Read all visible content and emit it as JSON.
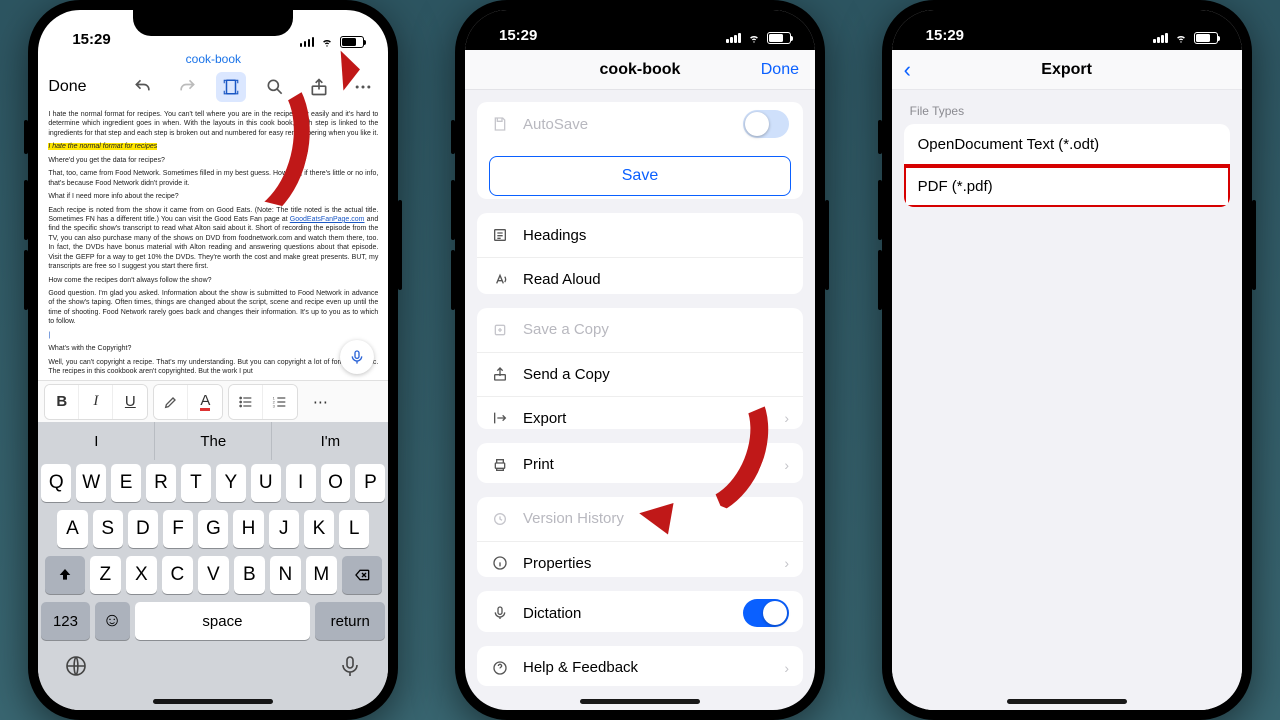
{
  "status": {
    "time": "15:29"
  },
  "phone1": {
    "doc_title": "cook-book",
    "done": "Done",
    "para_intro1": "I hate the normal format for recipes. You can't tell where you are in the recipe very easily and it's hard to determine which ingredient goes in when. With the layouts in this cook book, each step is linked to the ingredients for that step and each step is broken out and numbered for easy remembering when you like it.",
    "para_hl": "I hate the normal format for recipes",
    "para_q1": "Where'd you get the data for recipes?",
    "para_a1": "That, too, came from Food Network. Sometimes filled in my best guess. However, if there's little or no info, that's because Food Network didn't provide it.",
    "para_q2": "What if I need more info about the recipe?",
    "para_a2a": "Each recipe is noted from the show it came from on Good Eats. (Note: The title noted is the actual title. Sometimes FN has a different title.) You can visit the Good Eats Fan page at ",
    "para_link": "GoodEatsFanPage.com",
    "para_a2b": " and find the specific show's transcript to read what Alton said about it. Short of recording the episode from the TV, you can also purchase many of the shows on DVD from foodnetwork.com and watch them there, too. In fact, the DVDs have bonus material with Alton reading and answering questions about that episode. Visit the GEFP for a way to get 10% the DVDs. They're worth the cost and make great presents. BUT, my transcripts are free so I suggest you start there first.",
    "para_q3": "How come the recipes don't always follow the show?",
    "para_a3": "Good question. I'm glad you asked. Information about the show is submitted to Food Network in advance of the show's taping. Often times, things are changed about the script, scene and recipe even up until the time of shooting. Food Network rarely goes back and changes their information. It's up to you as to which to follow.",
    "para_q4": "What's with the Copyright?",
    "para_a4": "Well, you can't copyright a recipe. That's my understanding. But you can copyright a lot of formatting, etc. The recipes in this cookbook aren't copyrighted. But the work I put",
    "kb": {
      "sugg1": "I",
      "sugg2": "The",
      "sugg3": "I'm",
      "space": "space",
      "return": "return",
      "num": "123"
    }
  },
  "phone2": {
    "title": "cook-book",
    "done": "Done",
    "autosave": "AutoSave",
    "save": "Save",
    "headings": "Headings",
    "read_aloud": "Read Aloud",
    "save_copy": "Save a Copy",
    "send_copy": "Send a Copy",
    "export": "Export",
    "print": "Print",
    "version": "Version History",
    "properties": "Properties",
    "dictation": "Dictation",
    "help": "Help & Feedback"
  },
  "phone3": {
    "title": "Export",
    "section": "File Types",
    "odt": "OpenDocument Text (*.odt)",
    "pdf": "PDF (*.pdf)"
  }
}
